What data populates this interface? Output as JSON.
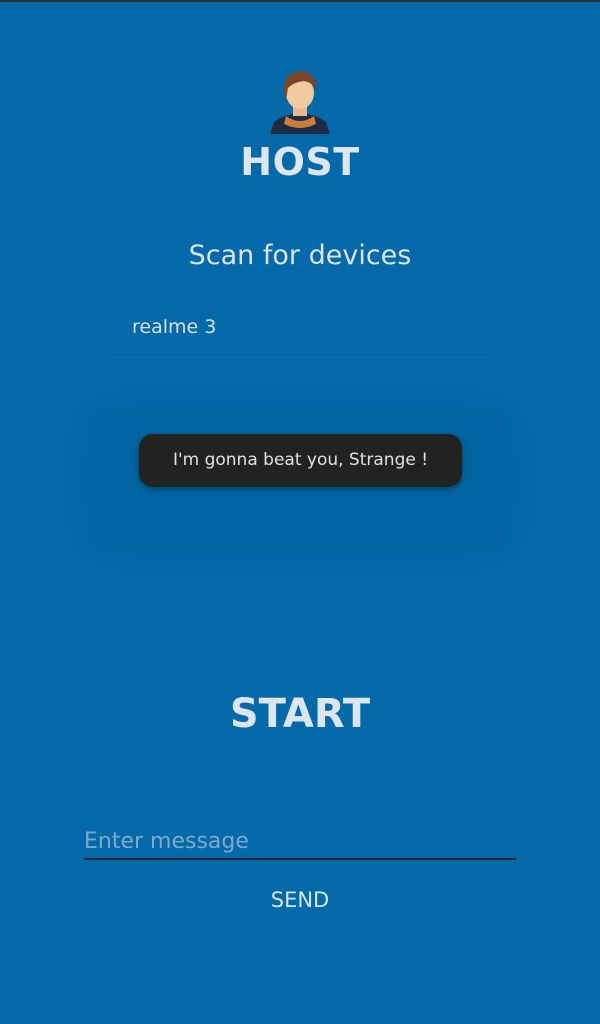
{
  "header": {
    "avatar_icon": "person-avatar-icon",
    "title": "HOST"
  },
  "scan": {
    "label": "Scan for devices"
  },
  "devices": [
    {
      "label": "realme 3"
    }
  ],
  "toast": {
    "text": "I'm gonna beat you, Strange !"
  },
  "start": {
    "label": "START"
  },
  "message": {
    "placeholder": "Enter message",
    "value": ""
  },
  "send": {
    "label": "SEND"
  },
  "colors": {
    "background": "#0369a8",
    "toast": "#222222",
    "text": "#dbe4ee"
  }
}
